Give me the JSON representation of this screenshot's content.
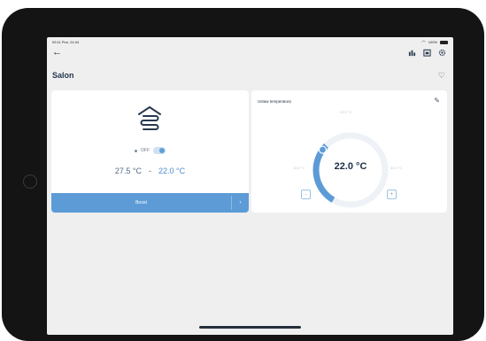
{
  "status_bar": {
    "left": "09:11  Pon. 24.04",
    "right": "100%"
  },
  "room": {
    "title": "Salon"
  },
  "heater": {
    "state_label": "OFF",
    "toggle_on": true,
    "current_temp": "27.5 °C",
    "separator": "-",
    "set_temp": "22.0 °C",
    "boost_label": "Boost",
    "more_label": "›"
  },
  "setpoint": {
    "title": "Ustaw temperaturę",
    "dial_value": "22.0 °C",
    "top_label": "23.0 °C",
    "left_label": "16.0 °C",
    "right_label": "30.0 °C",
    "minus_label": "-",
    "plus_label": "+",
    "progress": 0.35
  },
  "colors": {
    "accent": "#5c9bd6",
    "title": "#24364c",
    "screen_bg": "#efeff0"
  },
  "icons": [
    "back-arrow-icon",
    "chart-icon",
    "calendar-icon",
    "gear-icon",
    "heart-icon",
    "floor-heating-icon",
    "edit-icon",
    "wifi-icon",
    "battery-icon"
  ]
}
